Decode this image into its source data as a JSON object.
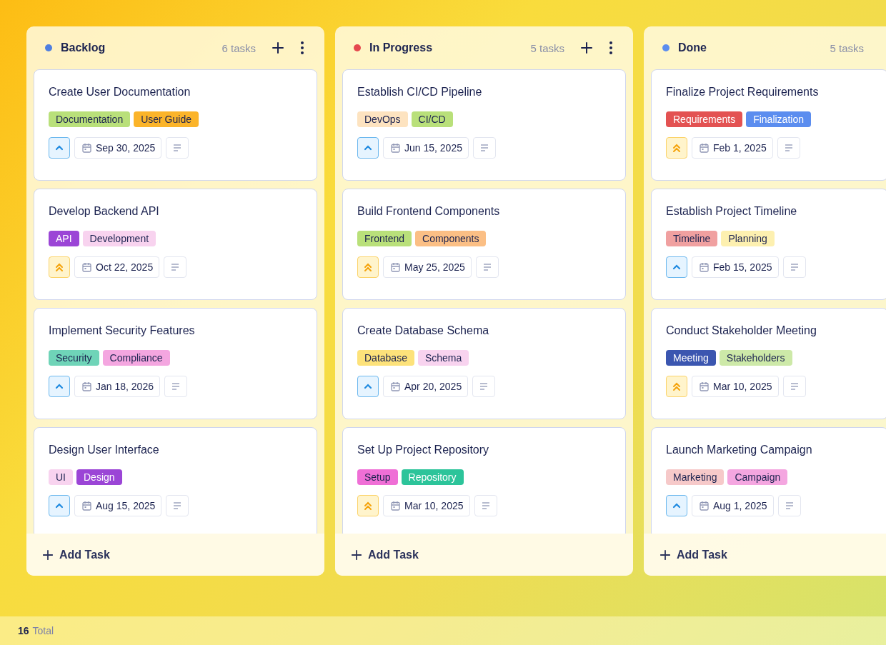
{
  "columns": [
    {
      "title": "Backlog",
      "color": "#4f7fe0",
      "count": "6 tasks",
      "actions_visible": true,
      "add_label": "Add Task",
      "cards": [
        {
          "title": "Create User Documentation",
          "tags": [
            {
              "label": "Documentation",
              "color": "#b9e07a"
            },
            {
              "label": "User Guide",
              "color": "#fbb42a"
            }
          ],
          "kind": "medium",
          "date": "Sep 30, 2025"
        },
        {
          "title": "Develop Backend API",
          "tags": [
            {
              "label": "API",
              "color": "#9b45d6"
            },
            {
              "label": "Development",
              "color": "#f8d3ef"
            }
          ],
          "kind": "high",
          "date": "Oct 22, 2025"
        },
        {
          "title": "Implement Security Features",
          "tags": [
            {
              "label": "Security",
              "color": "#6fd4b8"
            },
            {
              "label": "Compliance",
              "color": "#f4a6e0"
            }
          ],
          "kind": "medium",
          "date": "Jan 18, 2026"
        },
        {
          "title": "Design User Interface",
          "tags": [
            {
              "label": "UI",
              "color": "#f8d3ef"
            },
            {
              "label": "Design",
              "color": "#9b45d6"
            }
          ],
          "kind": "medium",
          "date": "Aug 15, 2025"
        }
      ]
    },
    {
      "title": "In Progress",
      "color": "#e5484d",
      "count": "5 tasks",
      "actions_visible": true,
      "add_label": "Add Task",
      "cards": [
        {
          "title": "Establish CI/CD Pipeline",
          "tags": [
            {
              "label": "DevOps",
              "color": "#fde3c0"
            },
            {
              "label": "CI/CD",
              "color": "#b9e07a"
            }
          ],
          "kind": "medium",
          "date": "Jun 15, 2025"
        },
        {
          "title": "Build Frontend Components",
          "tags": [
            {
              "label": "Frontend",
              "color": "#b9e07a"
            },
            {
              "label": "Components",
              "color": "#fbbf85"
            }
          ],
          "kind": "high",
          "date": "May 25, 2025"
        },
        {
          "title": "Create Database Schema",
          "tags": [
            {
              "label": "Database",
              "color": "#fde27a"
            },
            {
              "label": "Schema",
              "color": "#f8d3ef"
            }
          ],
          "kind": "medium",
          "date": "Apr 20, 2025"
        },
        {
          "title": "Set Up Project Repository",
          "tags": [
            {
              "label": "Setup",
              "color": "#ef6fd6"
            },
            {
              "label": "Repository",
              "color": "#2cc49a"
            }
          ],
          "kind": "high",
          "date": "Mar 10, 2025"
        }
      ]
    },
    {
      "title": "Done",
      "color": "#5b8def",
      "count": "5 tasks",
      "actions_visible": false,
      "add_label": "Add Task",
      "cards": [
        {
          "title": "Finalize Project Requirements",
          "tags": [
            {
              "label": "Requirements",
              "color": "#e35252"
            },
            {
              "label": "Finalization",
              "color": "#5b8def"
            }
          ],
          "kind": "high",
          "date": "Feb 1, 2025"
        },
        {
          "title": "Establish Project Timeline",
          "tags": [
            {
              "label": "Timeline",
              "color": "#f0a0a0"
            },
            {
              "label": "Planning",
              "color": "#fdf0b0"
            }
          ],
          "kind": "medium",
          "date": "Feb 15, 2025"
        },
        {
          "title": "Conduct Stakeholder Meeting",
          "tags": [
            {
              "label": "Meeting",
              "color": "#3b56b0"
            },
            {
              "label": "Stakeholders",
              "color": "#cde9a8"
            }
          ],
          "kind": "high",
          "date": "Mar 10, 2025"
        },
        {
          "title": "Launch Marketing Campaign",
          "tags": [
            {
              "label": "Marketing",
              "color": "#f6c9c9"
            },
            {
              "label": "Campaign",
              "color": "#f4a6e0"
            }
          ],
          "kind": "medium",
          "date": "Aug 1, 2025"
        }
      ]
    }
  ],
  "status_bar": {
    "count": "16",
    "label": "Total"
  }
}
